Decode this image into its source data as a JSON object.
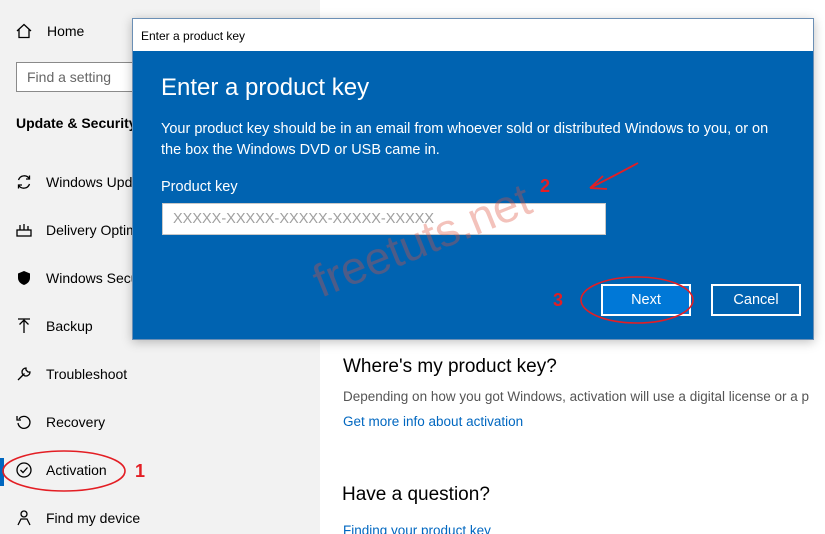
{
  "sidebar": {
    "home_label": "Home",
    "search_placeholder": "Find a setting",
    "section_title": "Update & Security",
    "items": [
      {
        "label": "Windows Update",
        "icon": "sync-icon"
      },
      {
        "label": "Delivery Optimization",
        "icon": "delivery-icon"
      },
      {
        "label": "Windows Security",
        "icon": "shield-icon"
      },
      {
        "label": "Backup",
        "icon": "backup-icon"
      },
      {
        "label": "Troubleshoot",
        "icon": "wrench-icon"
      },
      {
        "label": "Recovery",
        "icon": "recovery-icon"
      },
      {
        "label": "Activation",
        "icon": "check-circle-icon"
      },
      {
        "label": "Find my device",
        "icon": "person-icon"
      }
    ],
    "active_item": "Activation"
  },
  "main": {
    "product_key_heading": "Where's my product key?",
    "product_key_desc": "Depending on how you got Windows, activation will use a digital license or a p",
    "more_info_link": "Get more info about activation",
    "question_heading": "Have a question?",
    "finding_link": "Finding your product key"
  },
  "dialog": {
    "window_title": "Enter a product key",
    "heading": "Enter a product key",
    "description": "Your product key should be in an email from whoever sold or distributed Windows to you, or on the box the Windows DVD or USB came in.",
    "field_label": "Product key",
    "field_value": "",
    "field_placeholder": "XXXXX-XXXXX-XXXXX-XXXXX-XXXXX",
    "next_label": "Next",
    "cancel_label": "Cancel"
  },
  "annotations": {
    "step1": "1",
    "step2": "2",
    "step3": "3",
    "color": "#e31e24",
    "watermark": "freetuts.net"
  },
  "colors": {
    "dialog_blue": "#0063b1",
    "accent": "#0078d7",
    "link": "#0067c0"
  }
}
